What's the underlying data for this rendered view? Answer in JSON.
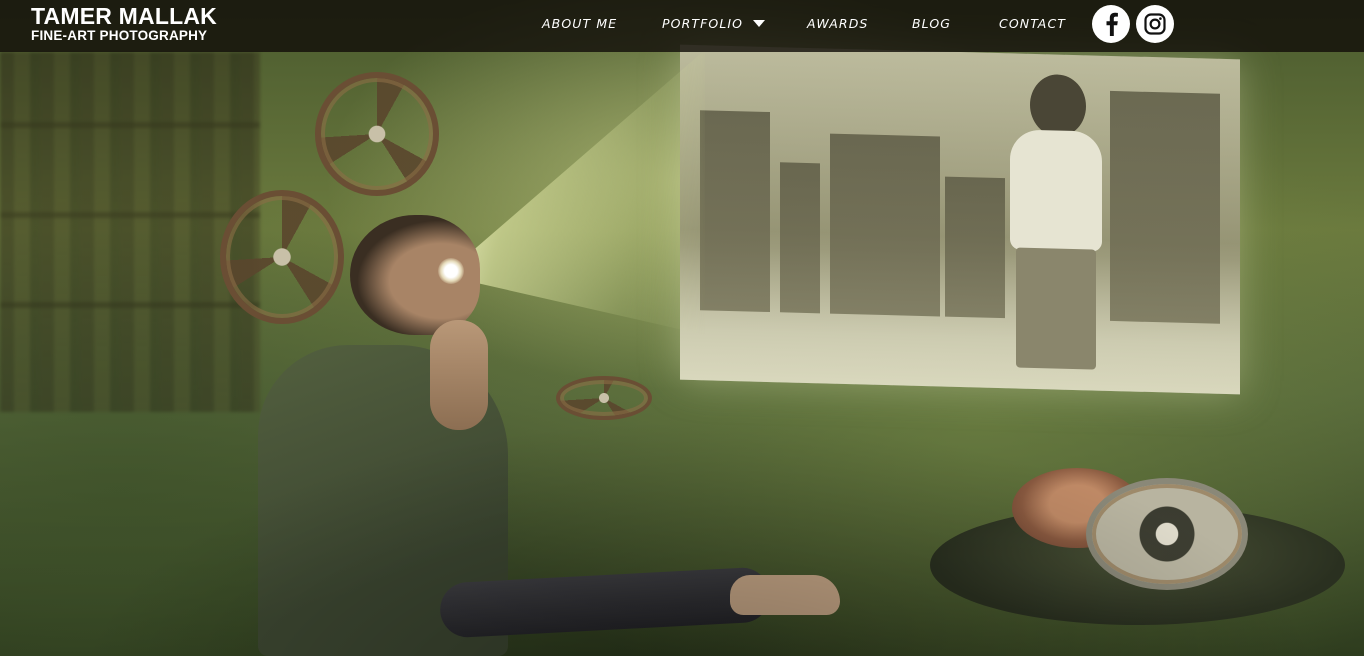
{
  "brand": {
    "name": "TAMER MALLAK",
    "tagline": "FINE-ART PHOTOGRAPHY"
  },
  "nav": {
    "items": [
      {
        "label": "ABOUT ME"
      },
      {
        "label": "PORTFOLIO",
        "has_dropdown": true
      },
      {
        "label": "AWARDS"
      },
      {
        "label": "BLOG"
      },
      {
        "label": "CONTACT"
      }
    ],
    "social": [
      {
        "icon": "facebook-icon"
      },
      {
        "icon": "instagram-icon"
      }
    ]
  },
  "colors": {
    "header_bg": "#120f0a",
    "nav_text": "#ffffff",
    "social_bg": "#ffffff",
    "social_glyph": "#111111"
  }
}
